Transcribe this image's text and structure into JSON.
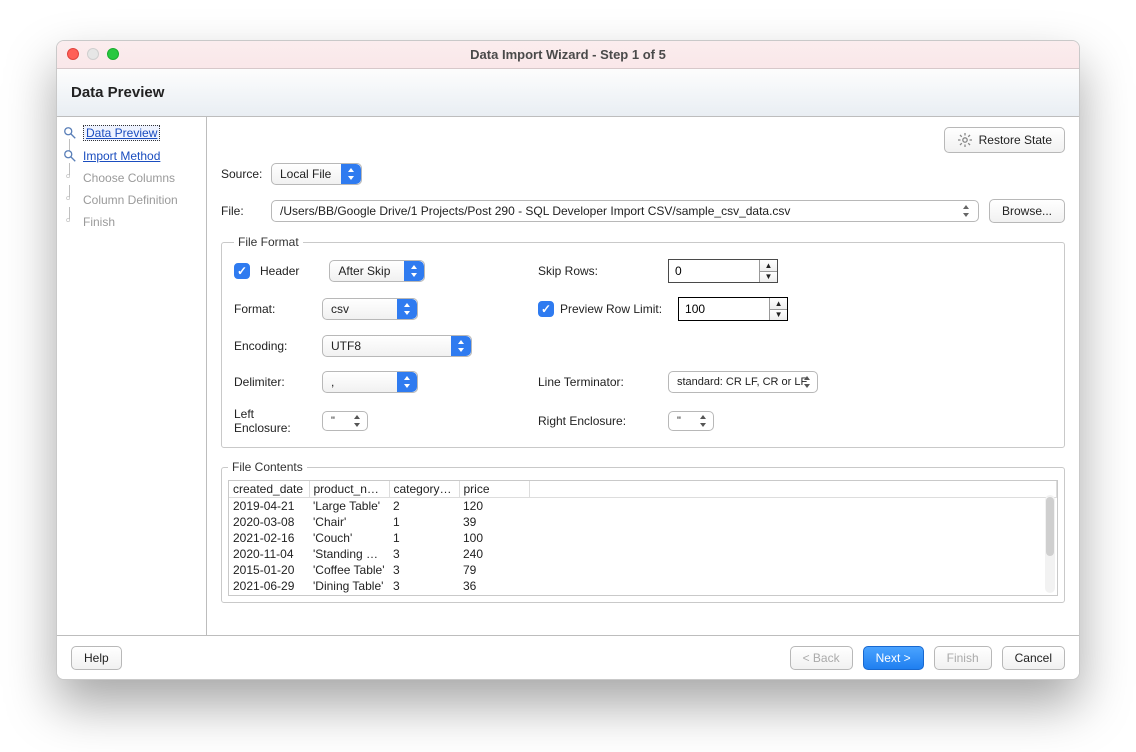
{
  "window": {
    "title": "Data Import Wizard - Step 1 of 5"
  },
  "header": {
    "title": "Data Preview"
  },
  "sidebar": {
    "steps": [
      {
        "label": "Data Preview"
      },
      {
        "label": "Import Method"
      },
      {
        "label": "Choose Columns"
      },
      {
        "label": "Column Definition"
      },
      {
        "label": "Finish"
      }
    ]
  },
  "restore_label": "Restore State",
  "source": {
    "label": "Source:",
    "value": "Local File"
  },
  "file": {
    "label": "File:",
    "path": "/Users/BB/Google Drive/1 Projects/Post 290 - SQL Developer Import CSV/sample_csv_data.csv",
    "browse": "Browse..."
  },
  "file_format": {
    "legend": "File Format",
    "header_label": "Header",
    "header_mode": "After Skip",
    "skip_rows_label": "Skip Rows:",
    "skip_rows_value": "0",
    "format_label": "Format:",
    "format_value": "csv",
    "preview_limit_label": "Preview Row Limit:",
    "preview_limit_value": "100",
    "encoding_label": "Encoding:",
    "encoding_value": "UTF8",
    "delimiter_label": "Delimiter:",
    "delimiter_value": ",",
    "line_term_label": "Line Terminator:",
    "line_term_value": "standard: CR LF, CR or LF",
    "left_encl_label": "Left Enclosure:",
    "left_encl_value": "\"",
    "right_encl_label": "Right Enclosure:",
    "right_encl_value": "\""
  },
  "file_contents": {
    "legend": "File Contents",
    "columns": [
      "created_date",
      "product_name",
      "category_id",
      "price"
    ],
    "rows": [
      [
        "2019-04-21",
        "'Large Table'",
        "2",
        "120"
      ],
      [
        "2020-03-08",
        "'Chair'",
        "1",
        "39"
      ],
      [
        "2021-02-16",
        "'Couch'",
        "1",
        "100"
      ],
      [
        "2020-11-04",
        "'Standing De...",
        "3",
        "240"
      ],
      [
        "2015-01-20",
        "'Coffee Table'",
        "3",
        "79"
      ],
      [
        "2021-06-29",
        "'Dining Table'",
        "3",
        "36"
      ]
    ]
  },
  "footer": {
    "help": "Help",
    "back": "< Back",
    "next": "Next >",
    "finish": "Finish",
    "cancel": "Cancel"
  }
}
